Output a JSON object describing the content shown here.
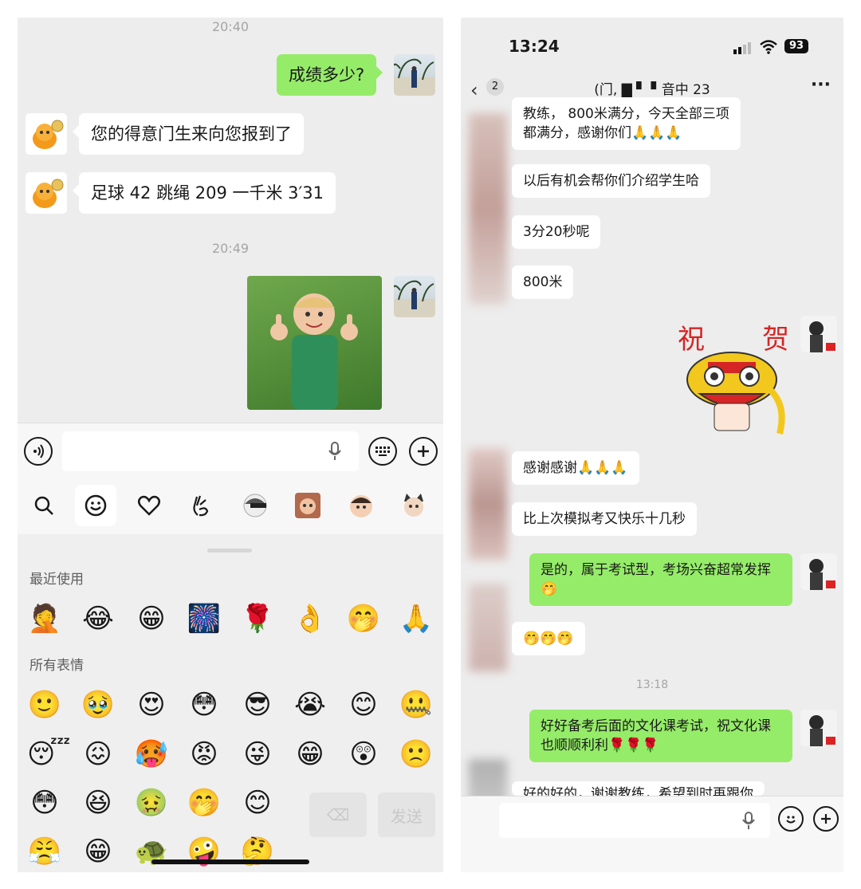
{
  "left": {
    "time1": "20:40",
    "msg_out_1": "成绩多少?",
    "msg_in_1": "您的得意门生来向您报到了",
    "msg_in_2": "足球 42 跳绳 209 一千米 3′31",
    "time2": "20:49",
    "photo_alt": "thumbs-up kid sticker",
    "input_placeholder": "",
    "tabs": [
      "search-icon",
      "smiley-icon",
      "heart-icon",
      "gesture-icon",
      "sticker-1",
      "sticker-2",
      "sticker-3",
      "sticker-4"
    ],
    "recent_label": "最近使用",
    "recent": [
      "🤦",
      "😂",
      "😁",
      "🎆",
      "🌹",
      "👌",
      "🤭",
      "🙏"
    ],
    "all_label": "所有表情",
    "all_rows": [
      [
        "🙂",
        "🥹",
        "😍",
        "😳",
        "😎",
        "😭",
        "😊",
        "🤐"
      ],
      [
        "😴",
        "😖",
        "🥵",
        "😡",
        "😜",
        "😁",
        "😲",
        "🙁"
      ],
      [
        "😳",
        "😆",
        "🤢",
        "🤭",
        "😊"
      ],
      [
        "😤",
        "😁",
        "🐢",
        "🤪",
        "🤔"
      ]
    ],
    "delete_label": "⌫",
    "send_label": "发送"
  },
  "right": {
    "status_time": "13:24",
    "battery": "93",
    "back_count": "2",
    "chat_title": "(门, ▇ ▘ ▘音中 23",
    "more": "···",
    "msgs": [
      "教练，    800米满分，今天全部三项\n都满分，感谢你们🙏🙏🙏",
      "以后有机会帮你们介绍学生哈",
      "3分20秒呢",
      "800米"
    ],
    "sticker_text_1": "祝",
    "sticker_text_2": "贺",
    "msgs2": [
      "感谢感谢🙏🙏🙏",
      "比上次模拟考又快乐十几秒"
    ],
    "out_1": "是的，属于考试型，考场兴奋超常发挥\n🤭",
    "in_emojis": "🤭🤭🤭",
    "time": "13:18",
    "out_2": "好好备考后面的文化课考试，祝文化课\n也顺顺利利🌹🌹🌹",
    "partial": "好的好的，谢谢教练，希望到时再跟你"
  }
}
